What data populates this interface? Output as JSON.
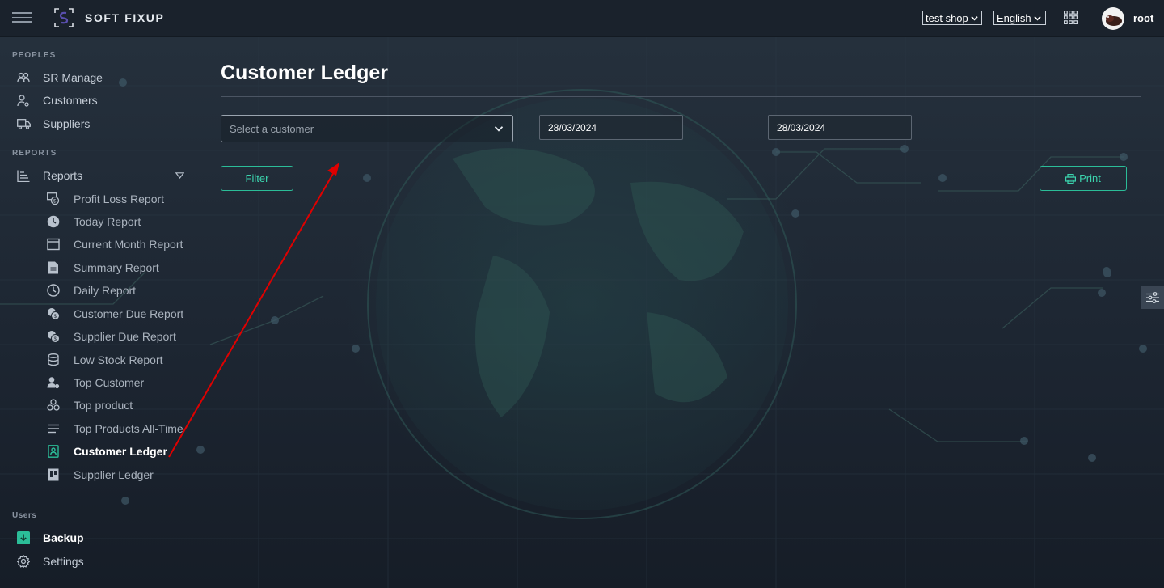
{
  "header": {
    "brand": "SOFT FIXUP",
    "shop": "test shop",
    "language": "English",
    "username": "root",
    "icons": [
      "menu-icon",
      "logo-icon",
      "apps-grid-icon",
      "avatar"
    ]
  },
  "sidebar": {
    "sections": {
      "peoples": "PEOPLES",
      "reports": "REPORTS",
      "users": "Users"
    },
    "peoples_items": [
      {
        "label": "SR Manage",
        "icon": "users-icon"
      },
      {
        "label": "Customers",
        "icon": "user-cog-icon"
      },
      {
        "label": "Suppliers",
        "icon": "truck-icon"
      }
    ],
    "reports_parent": {
      "label": "Reports",
      "icon": "reports-icon"
    },
    "report_items": [
      {
        "label": "Profit Loss Report",
        "icon": "money-icon"
      },
      {
        "label": "Today Report",
        "icon": "clock-icon"
      },
      {
        "label": "Current Month Report",
        "icon": "calendar-icon"
      },
      {
        "label": "Summary Report",
        "icon": "document-icon"
      },
      {
        "label": "Daily Report",
        "icon": "clock-outline-icon"
      },
      {
        "label": "Customer Due Report",
        "icon": "coins-icon"
      },
      {
        "label": "Supplier Due Report",
        "icon": "coins-icon"
      },
      {
        "label": "Low Stock Report",
        "icon": "database-icon"
      },
      {
        "label": "Top Customer",
        "icon": "user-star-icon"
      },
      {
        "label": "Top product",
        "icon": "cubes-icon"
      },
      {
        "label": "Top Products All-Time",
        "icon": "list-icon"
      },
      {
        "label": "Customer Ledger",
        "icon": "ledger-icon",
        "active": true
      },
      {
        "label": "Supplier Ledger",
        "icon": "book-icon"
      }
    ],
    "users_items": [
      {
        "label": "Backup",
        "icon": "download-icon"
      },
      {
        "label": "Settings",
        "icon": "gear-icon"
      }
    ]
  },
  "main": {
    "title": "Customer Ledger",
    "customer_select_placeholder": "Select a customer",
    "date_from": "28/03/2024",
    "date_to": "28/03/2024",
    "filter_label": "Filter",
    "print_label": "Print"
  },
  "colors": {
    "accent": "#2bbd98",
    "annotation_arrow": "#e00000"
  }
}
